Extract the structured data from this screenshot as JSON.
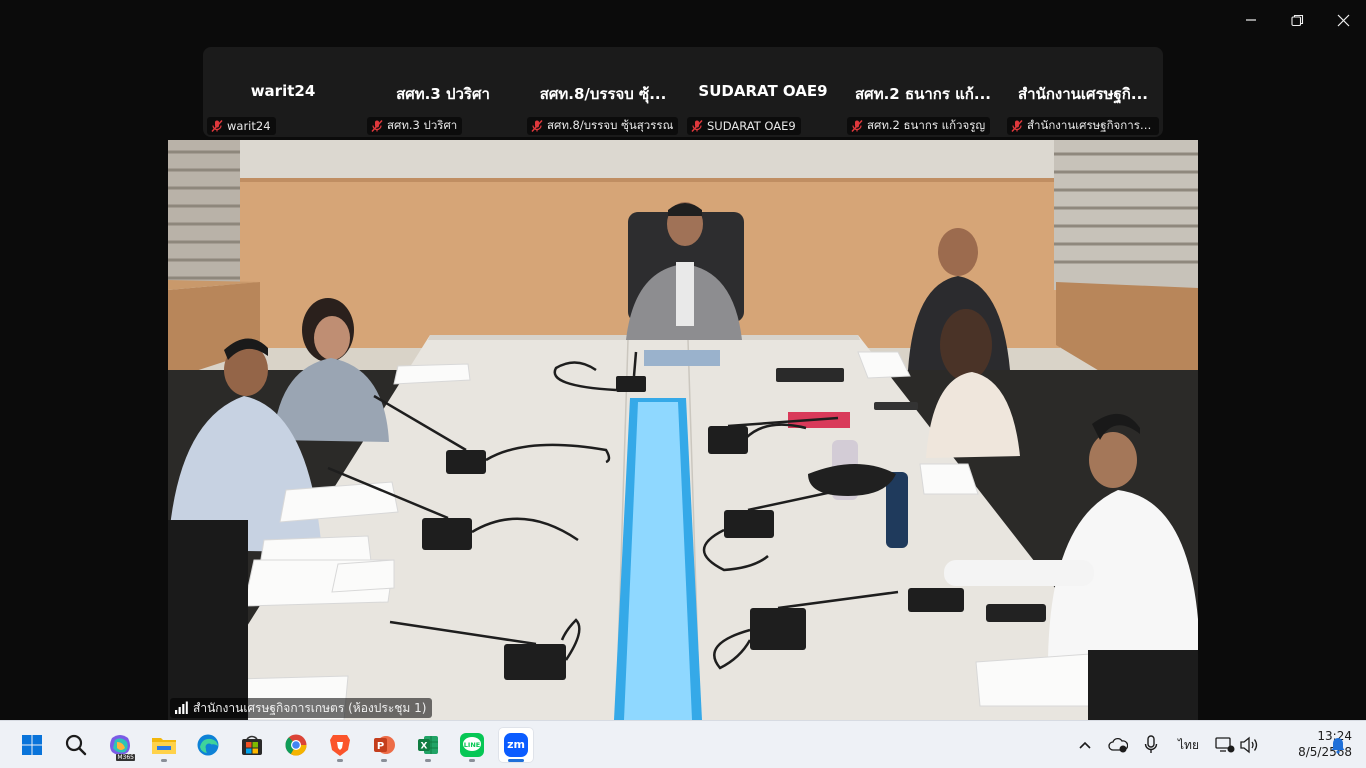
{
  "window_controls": {
    "minimize": "minimize-icon",
    "restore": "restore-icon",
    "close": "close-icon"
  },
  "participants": [
    {
      "name": "warit24",
      "label": "warit24"
    },
    {
      "name": "สศท.3  ปวริศา",
      "label": "สศท.3  ปวริศา"
    },
    {
      "name": "สศท.8/บรรจบ ซุ้...",
      "label": "สศท.8/บรรจบ ซุ้นสุวรรณ"
    },
    {
      "name": "SUDARAT OAE9",
      "label": "SUDARAT OAE9"
    },
    {
      "name": "สศท.2 ธนากร แก้...",
      "label": "สศท.2 ธนากร แก้วจรูญ"
    },
    {
      "name": "สำนักงานเศรษฐกิ...",
      "label": "สำนักงานเศรษฐกิจการเก..."
    }
  ],
  "main_video": {
    "label": "สำนักงานเศรษฐกิจการเกษตร (ห้องประชุม 1)"
  },
  "colors": {
    "muted_mic": "#e0383c",
    "zoom_blue": "#0b5cff",
    "accent": "#1e6fd9"
  },
  "taskbar": {
    "apps": [
      {
        "name": "start",
        "icon": "windows-start-icon"
      },
      {
        "name": "search",
        "icon": "search-icon"
      },
      {
        "name": "m365",
        "icon": "m365-copilot-icon",
        "label": "M365"
      },
      {
        "name": "file-explorer",
        "icon": "folder-icon"
      },
      {
        "name": "edge",
        "icon": "edge-browser-icon"
      },
      {
        "name": "store",
        "icon": "store-icon"
      },
      {
        "name": "chrome",
        "icon": "chrome-icon"
      },
      {
        "name": "brave",
        "icon": "brave-icon"
      },
      {
        "name": "powerpoint",
        "icon": "powerpoint-icon"
      },
      {
        "name": "excel",
        "icon": "excel-icon"
      },
      {
        "name": "line",
        "icon": "line-icon",
        "label": "LINE"
      },
      {
        "name": "zoom",
        "icon": "zoom-icon",
        "label": "zm"
      }
    ],
    "tray": {
      "language": "ไทย",
      "time": "13:24",
      "date": "8/5/2568"
    }
  }
}
